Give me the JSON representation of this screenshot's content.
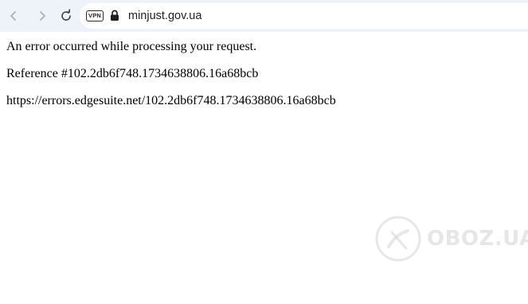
{
  "toolbar": {
    "back_icon": "chevron-left-icon",
    "forward_icon": "chevron-right-icon",
    "reload_icon": "reload-icon",
    "vpn_label": "VPN",
    "lock_icon": "lock-icon",
    "url": "minjust.gov.ua",
    "background": "#eef2f9"
  },
  "page": {
    "messages": [
      "An error occurred while processing your request.",
      "Reference #102.2db6f748.1734638806.16a68bcb",
      "https://errors.edgesuite.net/102.2db6f748.1734638806.16a68bcb"
    ]
  },
  "watermark": {
    "text": "OBOZ.UA",
    "icon": "oboz-logo-icon"
  }
}
